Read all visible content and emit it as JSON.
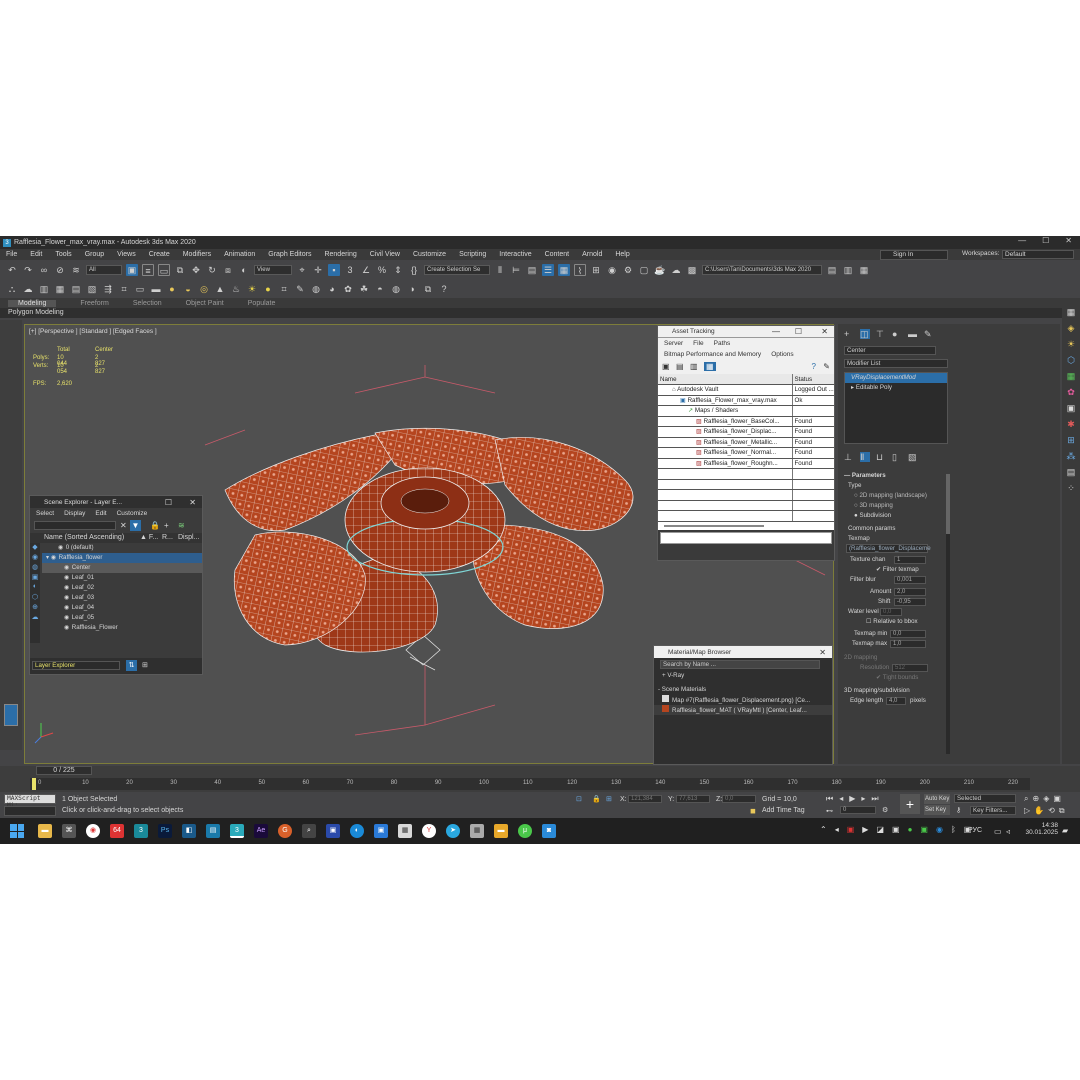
{
  "window": {
    "title": "Rafflesia_Flower_max_vray.max - Autodesk 3ds Max 2020",
    "minimize": "—",
    "maximize": "☐",
    "close": "✕"
  },
  "menu": [
    "File",
    "Edit",
    "Tools",
    "Group",
    "Views",
    "Create",
    "Modifiers",
    "Animation",
    "Graph Editors",
    "Rendering",
    "Civil View",
    "Customize",
    "Scripting",
    "Interactive",
    "Content",
    "Arnold",
    "Help"
  ],
  "account": {
    "sign_in": "Sign In",
    "workspaces_label": "Workspaces:",
    "workspace": "Default"
  },
  "toolbar": {
    "filter": "All",
    "ref_coord": "View",
    "selection_set": "Create Selection Se",
    "project_path": "C:\\Users\\Tan\\Documents\\3ds Max 2020"
  },
  "ribbon_tabs": [
    "Modeling",
    "Freeform",
    "Selection",
    "Object Paint",
    "Populate"
  ],
  "ribbon_sub": "Polygon Modeling",
  "viewport": {
    "label": "[+] [Perspective ] [Standard ] [Edged Faces ]",
    "stats": {
      "total_label": "Total",
      "center_label": "Center",
      "polys_label": "Polys:",
      "polys_total": "10 044",
      "polys_center": "2 827",
      "verts_label": "Verts:",
      "verts_total": "10 054",
      "verts_center": "2 827",
      "fps_label": "FPS:",
      "fps": "2,620"
    }
  },
  "scene_explorer": {
    "title": "Scene Explorer - Layer E...",
    "menu": [
      "Select",
      "Display",
      "Edit",
      "Customize"
    ],
    "columns": {
      "name": "Name (Sorted Ascending)",
      "f": "▲ F...",
      "r": "R...",
      "d": "Displ..."
    },
    "rows": [
      "0 (default)",
      "Rafflesia_flower",
      "Center",
      "Leaf_01",
      "Leaf_02",
      "Leaf_03",
      "Leaf_04",
      "Leaf_05",
      "Rafflesia_Flower"
    ],
    "footer": "Layer Explorer"
  },
  "asset_tracking": {
    "title": "Asset Tracking",
    "menu1": [
      "Server",
      "File",
      "Paths"
    ],
    "menu2": [
      "Bitmap Performance and Memory",
      "Options"
    ],
    "col_name": "Name",
    "col_status": "Status",
    "rows": [
      {
        "name": "Autodesk Vault",
        "status": "Logged Out ..."
      },
      {
        "name": "Rafflesia_Flower_max_vray.max",
        "status": "Ok"
      },
      {
        "name": "Maps / Shaders",
        "status": ""
      },
      {
        "name": "Rafflesia_flower_BaseCol...",
        "status": "Found"
      },
      {
        "name": "Rafflesia_flower_Displac...",
        "status": "Found"
      },
      {
        "name": "Rafflesia_flower_Metallic...",
        "status": "Found"
      },
      {
        "name": "Rafflesia_flower_Normal...",
        "status": "Found"
      },
      {
        "name": "Rafflesia_flower_Roughn...",
        "status": "Found"
      }
    ]
  },
  "material_browser": {
    "title": "Material/Map Browser",
    "search": "Search by Name ...",
    "vray": "+ V-Ray",
    "section": "- Scene Materials",
    "items": [
      "Map #7(Rafflesia_flower_Displacement.png) [Ce...",
      "Rafflesia_flower_MAT ( VRayMtl ) [Center, Leaf..."
    ]
  },
  "command_panel": {
    "object_name": "Center",
    "modifier_list": "Modifier List",
    "stack": [
      "VRayDisplacementMod",
      "Editable Poly"
    ],
    "params_title": "Parameters",
    "type_label": "Type",
    "type_options": [
      "2D mapping (landscape)",
      "3D mapping",
      "Subdivision"
    ],
    "common_label": "Common params",
    "texmap_label": "Texmap",
    "texmap_value": "(Rafflesia_flower_Displaceme",
    "texture_chan_label": "Texture chan",
    "texture_chan": "1",
    "filter_texmap": "Filter texmap",
    "filter_blur_label": "Filter blur",
    "filter_blur": "0,001",
    "amount_label": "Amount",
    "amount": "2,0",
    "shift_label": "Shift",
    "shift": "-0,95",
    "water_label": "Water level",
    "water": "0,0",
    "relative_bbox": "Relative to bbox",
    "texmap_min_label": "Texmap min",
    "texmap_min": "0,0",
    "texmap_max_label": "Texmap max",
    "texmap_max": "1,0",
    "map2d_label": "2D mapping",
    "resolution_label": "Resolution",
    "resolution": "512",
    "tight_bounds": "Tight bounds",
    "map3d_label": "3D mapping/subdivision",
    "edge_length_label": "Edge length",
    "edge_length": "4,0",
    "pixels": "pixels"
  },
  "timeline": {
    "frame": "0 / 225",
    "ticks": [
      "0",
      "10",
      "20",
      "30",
      "40",
      "50",
      "60",
      "70",
      "80",
      "90",
      "100",
      "110",
      "120",
      "130",
      "140",
      "150",
      "160",
      "170",
      "180",
      "190",
      "200",
      "210",
      "220"
    ]
  },
  "status": {
    "maxscript": "MAXScript Mi:",
    "selected": "1 Object Selected",
    "hint": "Click or click-and-drag to select objects",
    "x_label": "X:",
    "x": "121,384",
    "y_label": "Y:",
    "y": "77,613",
    "z_label": "Z:",
    "z": "0,0",
    "grid": "Grid = 10,0",
    "add_time_tag": "Add Time Tag",
    "auto_key": "Auto Key",
    "set_key": "Set Key",
    "selected_dd": "Selected",
    "key_filters": "Key Filters...",
    "frame_field": "0"
  },
  "taskbar": {
    "time": "14:38",
    "date": "30.01.2025",
    "lang": "РУС",
    "badge": "64"
  }
}
